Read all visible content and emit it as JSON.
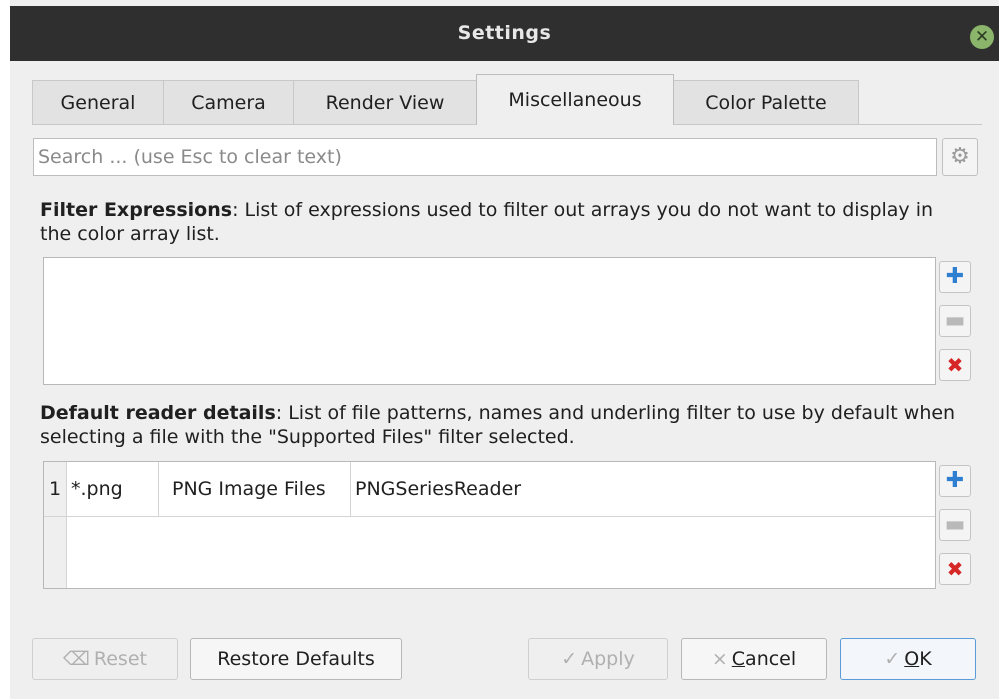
{
  "window": {
    "title": "Settings",
    "close_icon": "close-icon"
  },
  "tabs": [
    {
      "label": "General"
    },
    {
      "label": "Camera"
    },
    {
      "label": "Render View"
    },
    {
      "label": "Miscellaneous",
      "active": true
    },
    {
      "label": "Color Palette"
    }
  ],
  "search": {
    "placeholder": "Search ... (use Esc to clear text)"
  },
  "filter": {
    "title": "Filter Expressions",
    "description": ": List of expressions used to filter out arrays you do not want to display in the color array list.",
    "items": []
  },
  "reader": {
    "title": "Default reader details",
    "description": ": List of file patterns, names and underling filter to use by default when selecting a file with the \"Supported Files\" filter selected.",
    "rows": [
      {
        "num": "1",
        "pattern": "*.png",
        "name": "PNG Image Files",
        "reader": "PNGSeriesReader"
      }
    ]
  },
  "buttons": {
    "reset": "Reset",
    "restore": "Restore Defaults",
    "apply": "Apply",
    "cancel_prefix": "",
    "cancel_mnemonic": "C",
    "cancel_rest": "ancel",
    "ok_mnemonic": "O",
    "ok_rest": "K"
  },
  "colors": {
    "accent": "#2f7fd0",
    "danger": "#d62626",
    "titlebar": "#2f2f2f"
  }
}
